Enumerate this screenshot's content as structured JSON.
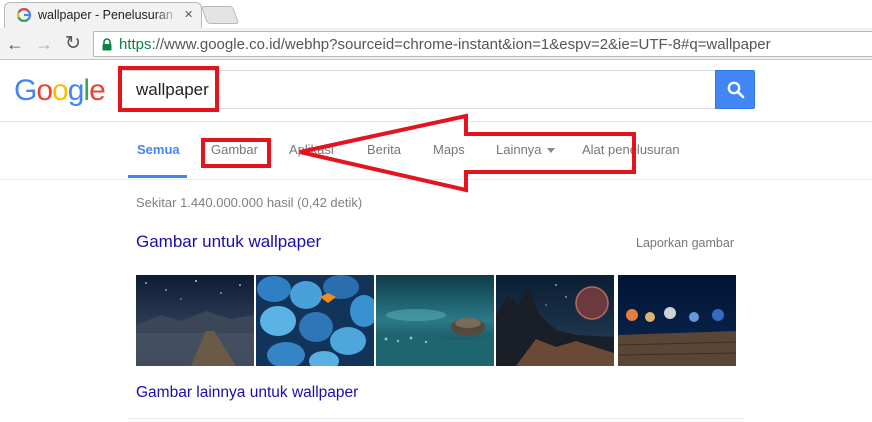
{
  "browser": {
    "tab_title": "wallpaper - Penelusuran G",
    "close_glyph": "✕",
    "back_glyph": "←",
    "forward_glyph": "→",
    "reload_glyph": "↻",
    "url_scheme": "https",
    "url_rest": "://www.google.co.id/webhp?sourceid=chrome-instant&ion=1&espv=2&ie=UTF-8#q=wallpaper"
  },
  "header": {
    "logo_letters": [
      "G",
      "o",
      "o",
      "g",
      "l",
      "e"
    ],
    "logo_colors": [
      "#4285f4",
      "#ea4335",
      "#fbbc05",
      "#4285f4",
      "#34a853",
      "#ea4335"
    ],
    "search_value": "wallpaper"
  },
  "nav": {
    "tabs": [
      "Semua",
      "Gambar",
      "Aplikasi",
      "Berita",
      "Maps",
      "Lainnya",
      "Alat penelusuran"
    ],
    "active": "Semua"
  },
  "results": {
    "stats": "Sekitar 1.440.000.000 hasil (0,42 detik)",
    "images_heading": "Gambar untuk wallpaper",
    "report_link": "Laporkan gambar",
    "more_link": "Gambar lainnya untuk wallpaper",
    "thumbnails": [
      "pier-night-sky",
      "blue-pebbles-butterfly",
      "stone-on-water",
      "fantasy-planet-landscape",
      "bokeh-lights-wood"
    ]
  },
  "colors": {
    "accent": "#4285f4",
    "link": "#1a0dab",
    "annotation": "#e3141e"
  }
}
